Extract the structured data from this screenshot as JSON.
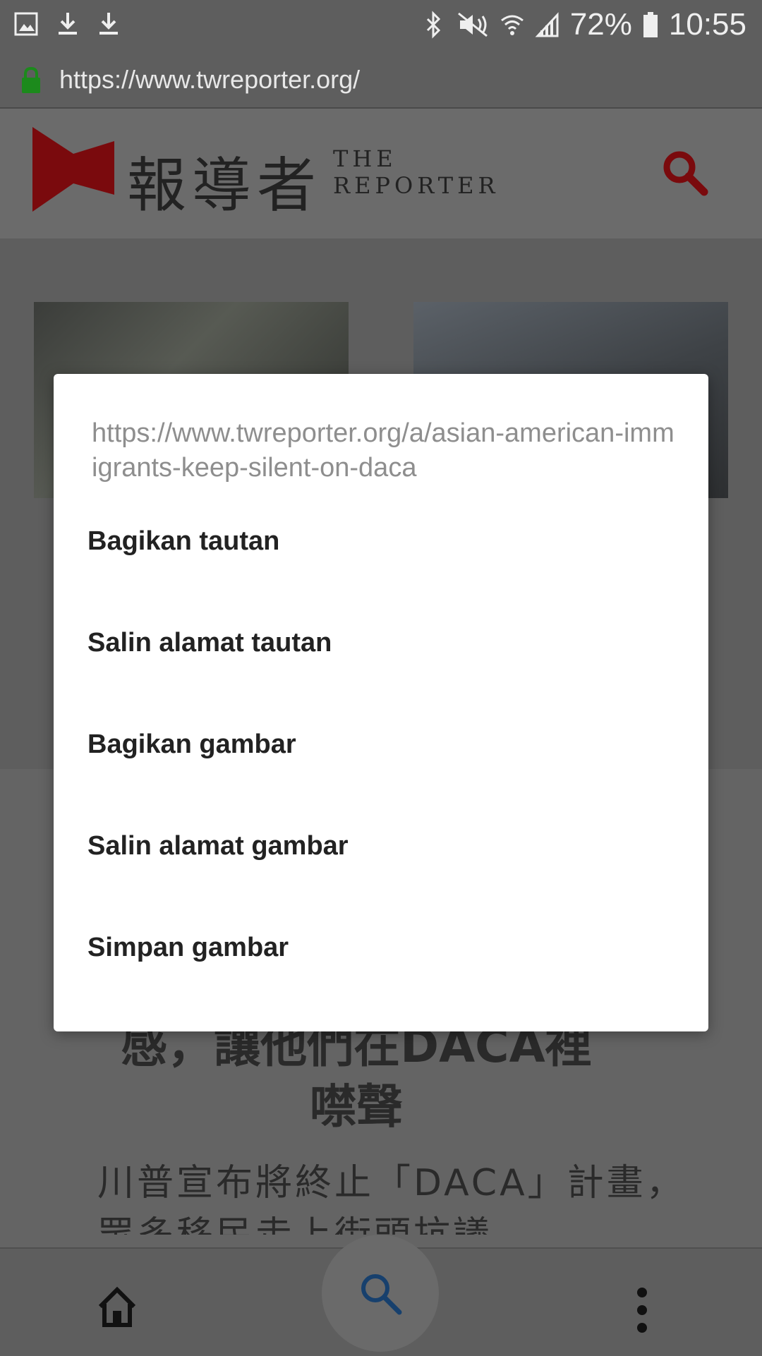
{
  "status_bar": {
    "battery": "72%",
    "time": "10:55"
  },
  "browser": {
    "url": "https://www.twreporter.org/"
  },
  "site_header": {
    "logo_zh": "報導者",
    "logo_en_line1": "THE",
    "logo_en_line2": "REPORTER"
  },
  "article": {
    "title_line1": "感，讓他們在DACA裡",
    "title_line2": "噤聲",
    "lead": "川普宣布將終止「DACA」計畫，眾多移民走上街頭抗議，"
  },
  "context_menu": {
    "link_url": "https://www.twreporter.org/a/asian-american-immigrants-keep-silent-on-daca",
    "items": [
      "Bagikan tautan",
      "Salin alamat tautan",
      "Bagikan gambar",
      "Salin alamat gambar",
      "Simpan gambar"
    ]
  }
}
